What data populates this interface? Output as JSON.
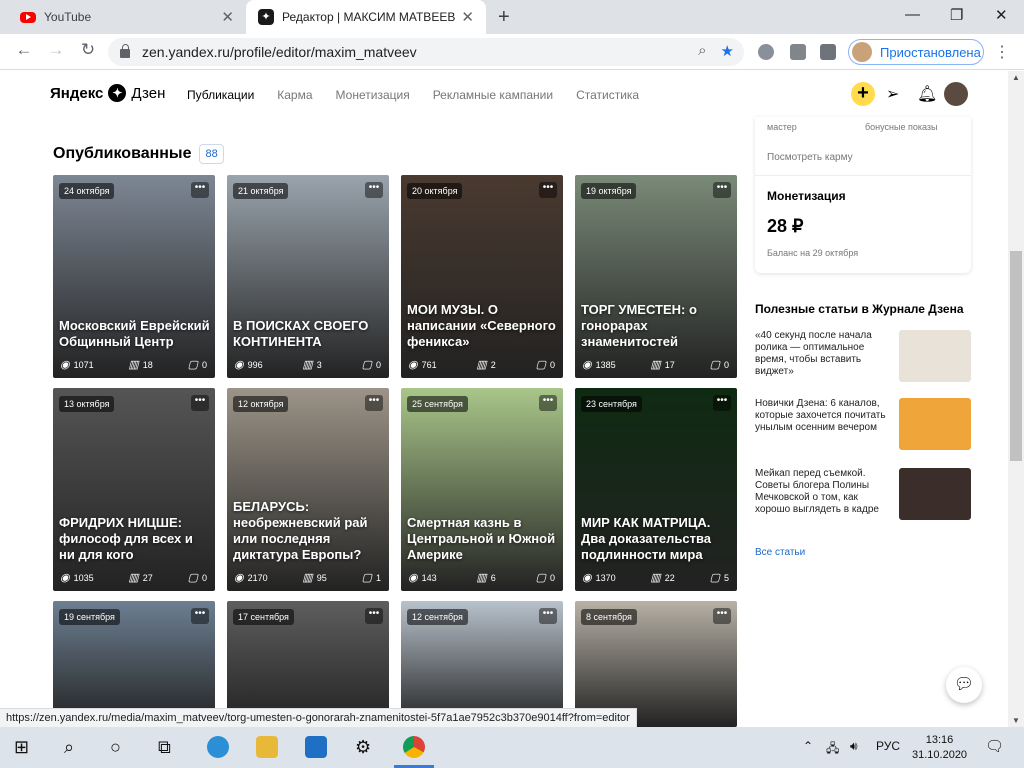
{
  "browser": {
    "tabs": [
      {
        "title": "YouTube"
      },
      {
        "title": "Редактор | МАКСИМ МАТВЕЕВ | Я"
      }
    ],
    "url": "zen.yandex.ru/profile/editor/maxim_matveev",
    "profile_label": "Приостановлена",
    "status_url": "https://zen.yandex.ru/media/maxim_matveev/torg-umesten-o-gonorarah-znamenitostei-5f7a1ae7952c3b370e9014ff?from=editor"
  },
  "header": {
    "logo_left": "Яндекс",
    "logo_right": "Дзен",
    "nav": [
      "Публикации",
      "Карма",
      "Монетизация",
      "Рекламные кампании",
      "Статистика"
    ]
  },
  "main": {
    "section_title": "Опубликованные",
    "count": "88",
    "cards": [
      {
        "date": "24 октября",
        "title": "Московский Еврейский Общинный Центр",
        "views": "1071",
        "reads": "18",
        "comments": "0",
        "color": "#7d8794"
      },
      {
        "date": "21 октября",
        "title": "В ПОИСКАХ СВОЕГО КОНТИНЕНТА",
        "views": "996",
        "reads": "3",
        "comments": "0",
        "color": "#9aa4ad"
      },
      {
        "date": "20 октября",
        "title": "МОИ МУЗЫ. О написании «Северного феникса»",
        "views": "761",
        "reads": "2",
        "comments": "0",
        "color": "#4a3a30"
      },
      {
        "date": "19 октября",
        "title": "ТОРГ УМЕСТЕН: о гонорарах знаменитостей",
        "views": "1385",
        "reads": "17",
        "comments": "0",
        "color": "#7a8a78"
      },
      {
        "date": "13 октября",
        "title": "ФРИДРИХ НИЦШЕ: философ для всех и ни для кого",
        "views": "1035",
        "reads": "27",
        "comments": "0",
        "color": "#555555"
      },
      {
        "date": "12 октября",
        "title": "БЕЛАРУСЬ: необрежневский рай или последняя диктатура Европы?",
        "views": "2170",
        "reads": "95",
        "comments": "1",
        "color": "#9c9488"
      },
      {
        "date": "25 сентября",
        "title": "Смертная казнь в Центральной и Южной Америке",
        "views": "143",
        "reads": "6",
        "comments": "0",
        "color": "#a9c68a"
      },
      {
        "date": "23 сентября",
        "title": "МИР КАК МАТРИЦА. Два доказательства подлинности мира",
        "views": "1370",
        "reads": "22",
        "comments": "5",
        "color": "#0f2a12"
      },
      {
        "date": "19 сентября",
        "title": "",
        "views": "",
        "reads": "",
        "comments": "",
        "color": "#6d7f92"
      },
      {
        "date": "17 сентября",
        "title": "",
        "views": "",
        "reads": "",
        "comments": "",
        "color": "#5e5e5e"
      },
      {
        "date": "12 сентября",
        "title": "",
        "views": "",
        "reads": "",
        "comments": "",
        "color": "#b8c2cc"
      },
      {
        "date": "8 сентября",
        "title": "",
        "views": "",
        "reads": "",
        "comments": "",
        "color": "#b7b1a6"
      }
    ]
  },
  "sidebar": {
    "karma_label_left": "мастер",
    "karma_label_right": "бонусные показы",
    "karma_link": "Посмотреть карму",
    "monet_title": "Монетизация",
    "monet_value": "28 ₽",
    "monet_balance": "Баланс на 29 октября",
    "useful_title": "Полезные статьи в Журнале Дзена",
    "articles": [
      {
        "text": "«40 секунд после начала ролика — оптимальное время, чтобы вставить виджет»",
        "color": "#e8e2d8"
      },
      {
        "text": "Новички Дзена: 6 каналов, которые захочется почитать унылым осенним вечером",
        "color": "#f0a53a"
      },
      {
        "text": "Мейкап перед съемкой. Советы блогера Полины Мечковской о том, как хорошо выглядеть в кадре",
        "color": "#3b2d2a"
      }
    ],
    "all_link": "Все статьи"
  },
  "taskbar": {
    "lang": "РУС",
    "time": "13:16",
    "date": "31.10.2020"
  }
}
